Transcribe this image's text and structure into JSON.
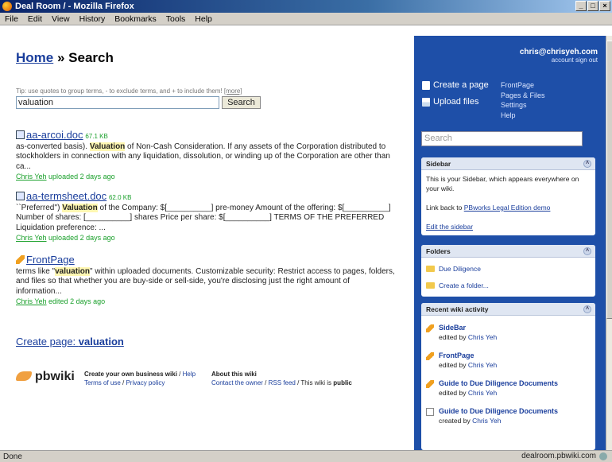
{
  "window": {
    "title": "Deal Room / - Mozilla Firefox",
    "controls": [
      "_",
      "□",
      "×"
    ]
  },
  "menu": [
    "File",
    "Edit",
    "View",
    "History",
    "Bookmarks",
    "Tools",
    "Help"
  ],
  "page": {
    "breadcrumb_home": "Home",
    "breadcrumb_sep": "»",
    "title": "Search",
    "tip": "Tip: use quotes to group terms, - to exclude terms, and + to include them!",
    "tip_more": "[more]",
    "search_value": "valuation",
    "search_button": "Search"
  },
  "results": [
    {
      "title": "aa-arcoi.doc",
      "size": "67.1 KB",
      "snippet_pre": "as-converted basis). ",
      "snippet_hl": "Valuation",
      "snippet_post": " of Non-Cash Consideration. If any assets of the Corporation distributed to stockholders in connection with any liquidation, dissolution, or winding up of the Corporation are other than ca...",
      "author": "Chris Yeh",
      "action": "uploaded 2 days ago"
    },
    {
      "title": "aa-termsheet.doc",
      "size": "62.0 KB",
      "snippet_pre": "``Preferred'') ",
      "snippet_hl": "Valuation",
      "snippet_post": " of the Company: $[__________] pre-money Amount of the offering: $[__________] Number of shares: [__________] shares Price per share: $[__________] TERMS OF THE PREFERRED Liquidation preference: ...",
      "author": "Chris Yeh",
      "action": "uploaded 2 days ago"
    },
    {
      "title": "FrontPage",
      "size": "",
      "snippet_pre": "terms like \"",
      "snippet_hl": "valuation",
      "snippet_post": "\" within uploaded documents. Customizable security: Restrict access to pages, folders, and files so that whether you are buy-side or sell-side, you're disclosing just the right amount of information...",
      "author": "Chris Yeh",
      "action": "edited 2 days ago"
    }
  ],
  "create_page": {
    "prefix": "Create page: ",
    "term": "valuation"
  },
  "footer": {
    "logo": "pbwiki",
    "create_wiki": "Create your own business wiki",
    "help": "Help",
    "terms": "Terms of use",
    "privacy": "Privacy policy",
    "about": "About this wiki",
    "contact": "Contact the owner",
    "rss": "RSS feed",
    "wiki_is": "This wiki is",
    "public": "public"
  },
  "sidebar": {
    "email": "chris@chrisyeh.com",
    "account": "account",
    "sign_out": "sign out",
    "create_page": "Create a page",
    "upload_files": "Upload files",
    "links": [
      "FrontPage",
      "Pages & Files",
      "Settings",
      "Help"
    ],
    "search_placeholder": "Search",
    "sidebar_panel": {
      "title": "Sidebar",
      "text1": "This is your Sidebar, which appears everywhere on your wiki.",
      "link_prefix": "Link back to ",
      "link_text": "PBworks Legal Edition demo",
      "edit": "Edit the sidebar"
    },
    "folders_panel": {
      "title": "Folders",
      "items": [
        "Due Diligence",
        "Create a folder..."
      ]
    },
    "activity_panel": {
      "title": "Recent wiki activity",
      "items": [
        {
          "title": "SideBar",
          "verb": "edited by",
          "author": "Chris Yeh"
        },
        {
          "title": "FrontPage",
          "verb": "edited by",
          "author": "Chris Yeh"
        },
        {
          "title": "Guide to Due Diligence Documents",
          "verb": "edited by",
          "author": "Chris Yeh"
        },
        {
          "title": "Guide to Due Diligence Documents",
          "verb": "created by",
          "author": "Chris Yeh"
        }
      ]
    }
  },
  "status": {
    "left": "Done",
    "host": "dealroom.pbwiki.com"
  }
}
